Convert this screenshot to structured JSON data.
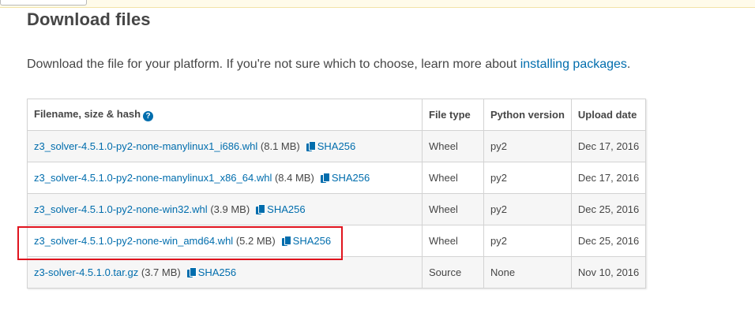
{
  "page": {
    "title": "Download files",
    "intro_text": "Download the file for your platform. If you're not sure which to choose, learn more about ",
    "intro_link": "installing packages",
    "intro_end": "."
  },
  "table": {
    "headers": {
      "filename": "Filename, size & hash",
      "file_type": "File type",
      "python_version": "Python version",
      "upload_date": "Upload date"
    },
    "rows": [
      {
        "filename": "z3_solver-4.5.1.0-py2-none-manylinux1_i686.whl",
        "size": "(8.1 MB)",
        "hash": "SHA256",
        "file_type": "Wheel",
        "python_version": "py2",
        "upload_date": "Dec 17, 2016"
      },
      {
        "filename": "z3_solver-4.5.1.0-py2-none-manylinux1_x86_64.whl",
        "size": "(8.4 MB)",
        "hash": "SHA256",
        "file_type": "Wheel",
        "python_version": "py2",
        "upload_date": "Dec 17, 2016"
      },
      {
        "filename": "z3_solver-4.5.1.0-py2-none-win32.whl",
        "size": "(3.9 MB)",
        "hash": "SHA256",
        "file_type": "Wheel",
        "python_version": "py2",
        "upload_date": "Dec 25, 2016"
      },
      {
        "filename": "z3_solver-4.5.1.0-py2-none-win_amd64.whl",
        "size": "(5.2 MB)",
        "hash": "SHA256",
        "file_type": "Wheel",
        "python_version": "py2",
        "upload_date": "Dec 25, 2016"
      },
      {
        "filename": "z3-solver-4.5.1.0.tar.gz",
        "size": "(3.7 MB)",
        "hash": "SHA256",
        "file_type": "Source",
        "python_version": "None",
        "upload_date": "Nov 10, 2016"
      }
    ]
  },
  "icons": {
    "help": "question-circle-icon",
    "hash": "copy-icon"
  },
  "colors": {
    "link": "#006dad",
    "highlight": "#e0141e",
    "text": "#464646"
  }
}
